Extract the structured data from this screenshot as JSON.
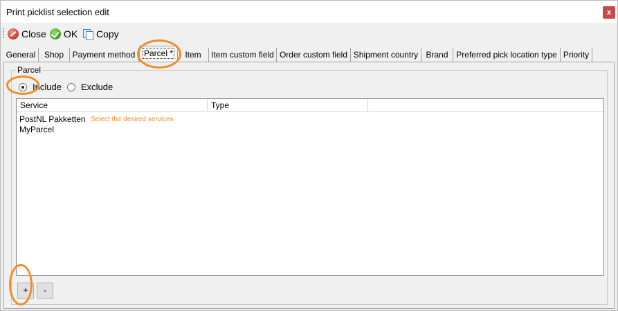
{
  "window": {
    "title": "Print picklist selection edit",
    "close_glyph": "x"
  },
  "toolbar": {
    "close_label": "Close",
    "ok_label": "OK",
    "copy_label": "Copy"
  },
  "tabs": [
    {
      "label": "General"
    },
    {
      "label": "Shop"
    },
    {
      "label": "Payment method"
    },
    {
      "label": "Parcel *"
    },
    {
      "label": "Item"
    },
    {
      "label": "Item custom field"
    },
    {
      "label": "Order custom field"
    },
    {
      "label": "Shipment country"
    },
    {
      "label": "Brand"
    },
    {
      "label": "Preferred pick location type"
    },
    {
      "label": "Priority"
    }
  ],
  "active_tab": "Parcel *",
  "parcel": {
    "group_title": "Parcel",
    "include_label": "Include",
    "exclude_label": "Exclude",
    "selected": "Include",
    "columns": [
      "Service",
      "Type"
    ],
    "rows": [
      {
        "service": "PostNL Pakketten",
        "type": ""
      },
      {
        "service": "MyParcel",
        "type": ""
      }
    ],
    "hint": "Select the desired services",
    "add_label": "+",
    "remove_label": "-"
  },
  "colors": {
    "annotation": "#f28c28",
    "title_close_bg": "#c94a4a"
  },
  "icons": {
    "close": "close-circle-icon",
    "ok": "check-circle-icon",
    "copy": "copy-icon"
  }
}
